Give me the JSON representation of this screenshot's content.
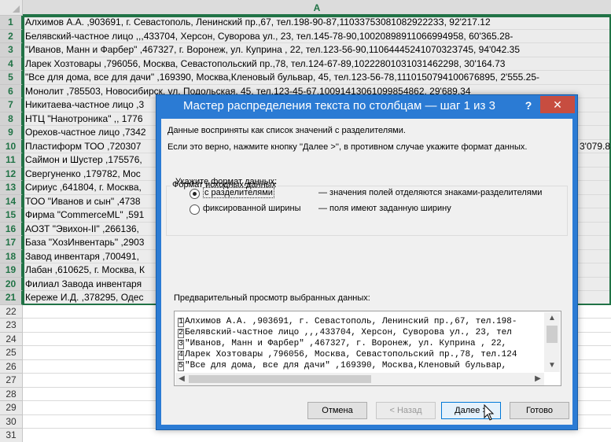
{
  "sheet": {
    "column_header": "A",
    "rows": [
      {
        "num": "1",
        "text": "Алхимов А.А. ,903691, г. Севастополь, Ленинский пр.,67, тел.198-90-87,1103375308108292223З, 92'217.12"
      },
      {
        "num": "2",
        "text": "Белявский-частное лицо ,,,433704,  Херсон, Суворова ул., 23, тел.145-78-90,10020898911066994958, 60'365.28-"
      },
      {
        "num": "3",
        "text": "\"Иванов, Манн и Фарбер\" ,467327, г. Воронеж, ул. Куприна  , 22, тел.123-56-90,1106444524107032З745, 94'042.35"
      },
      {
        "num": "4",
        "text": "Ларек Хозтовары ,796056, Москва, Севастопольский пр.,78, тел.124-67-89,10222801031031462298, 30'164.73"
      },
      {
        "num": "5",
        "text": "\"Все для дома, все для дачи\" ,169390, Москва,Кленовый   бульвар, 45, тел.123-56-78,1110150794100676895, 2'555.25-"
      },
      {
        "num": "6",
        "text": "Монолит ,785503, Новосибирск, ул. Подольская, 45, тел.123-45-67,10091413061099854862, 29'689.34"
      },
      {
        "num": "7",
        "text": "Никитаева-частное лицо ,3"
      },
      {
        "num": "8",
        "text": "НТЦ \"Нанотроника\" ,,   1776"
      },
      {
        "num": "9",
        "text": "Орехов-частное лицо ,7342"
      },
      {
        "num": "10",
        "text": "Пластиформ ТОО ,720307"
      },
      {
        "num": "11",
        "text": "Саймон и Шустер ,175576,"
      },
      {
        "num": "12",
        "text": "Свергуненко ,179782, Мос"
      },
      {
        "num": "13",
        "text": "Сириус ,641804, г. Москва,"
      },
      {
        "num": "14",
        "text": "ТОО \"Иванов и сын\" ,4738"
      },
      {
        "num": "15",
        "text": "Фирма \"CommerceML\" ,591"
      },
      {
        "num": "16",
        "text": "АОЗТ \"Эвихон-II\" ,266136,"
      },
      {
        "num": "17",
        "text": "База \"ХозИнвентарь\" ,2903"
      },
      {
        "num": "18",
        "text": "Завод инвентаря ,700491,"
      },
      {
        "num": "19",
        "text": "Лабан ,610625, г. Москва, К"
      },
      {
        "num": "20",
        "text": "Филиал Завода инвентаря"
      },
      {
        "num": "21",
        "text": "Кереже И.Д. ,378295, Одес"
      }
    ],
    "row10_overflow": "3'079.8",
    "empty_rows": [
      "22",
      "23",
      "24",
      "25",
      "26",
      "27",
      "28",
      "29",
      "30",
      "31"
    ]
  },
  "dialog": {
    "title": "Мастер распределения текста по столбцам — шаг 1 из 3",
    "help_label": "?",
    "close_label": "✕",
    "info_line1": "Данные восприняты как список значений с разделителями.",
    "info_line2": "Если это верно, нажмите кнопку ''Далее >'', в противном случае укажите формат данных.",
    "group_title": "Формат исходных данных",
    "format_prompt": "Укажите формат данных:",
    "options": [
      {
        "label": "с разделителями",
        "description": "— значения полей отделяются знаками-разделителями",
        "selected": true
      },
      {
        "label": "фиксированной ширины",
        "description": "— поля имеют заданную ширину",
        "selected": false
      }
    ],
    "preview_title": "Предварительный просмотр выбранных данных:",
    "preview_lines": [
      {
        "num": "1",
        "text": "Алхимов А.А. ,903691, г. Севастополь, Ленинский пр.,67, тел.198-"
      },
      {
        "num": "2",
        "text": "Белявский-частное лицо ,,,433704,  Херсон, Суворова ул., 23, тел"
      },
      {
        "num": "3",
        "text": "\"Иванов, Манн и Фарбер\" ,467327, г. Воронеж, ул. Куприна  , 22,"
      },
      {
        "num": "4",
        "text": "Ларек Хозтовары ,796056, Москва, Севастопольский пр.,78, тел.124"
      },
      {
        "num": "5",
        "text": "\"Все для дома, все для дачи\" ,169390, Москва,Кленовый  бульвар,"
      }
    ],
    "buttons": {
      "cancel": "Отмена",
      "back": "< Назад",
      "next": "Далее >",
      "finish": "Готово"
    }
  },
  "colors": {
    "excel_green": "#217346",
    "dialog_frame": "#2b7bd4",
    "close_red": "#c74d40"
  }
}
